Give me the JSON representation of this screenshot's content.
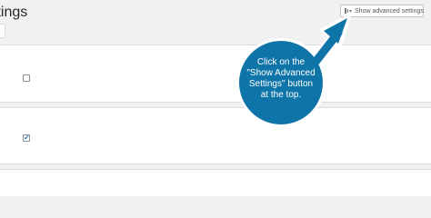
{
  "header": {
    "title_fragment": "ttings"
  },
  "toolbar": {
    "advanced_label": "Show advanced settings",
    "advanced_icon": "grid-icon",
    "chevron_icon": "chevron-down-icon"
  },
  "settings": {
    "rows": [
      {
        "checked": false
      },
      {
        "checked": true,
        "check_glyph": "✓"
      }
    ]
  },
  "callout": {
    "lines": [
      "Click on the",
      "\"Show Advanced",
      "Settings\" button",
      "at the top."
    ],
    "color": "#0f74a8",
    "outline": "#ffffff"
  }
}
